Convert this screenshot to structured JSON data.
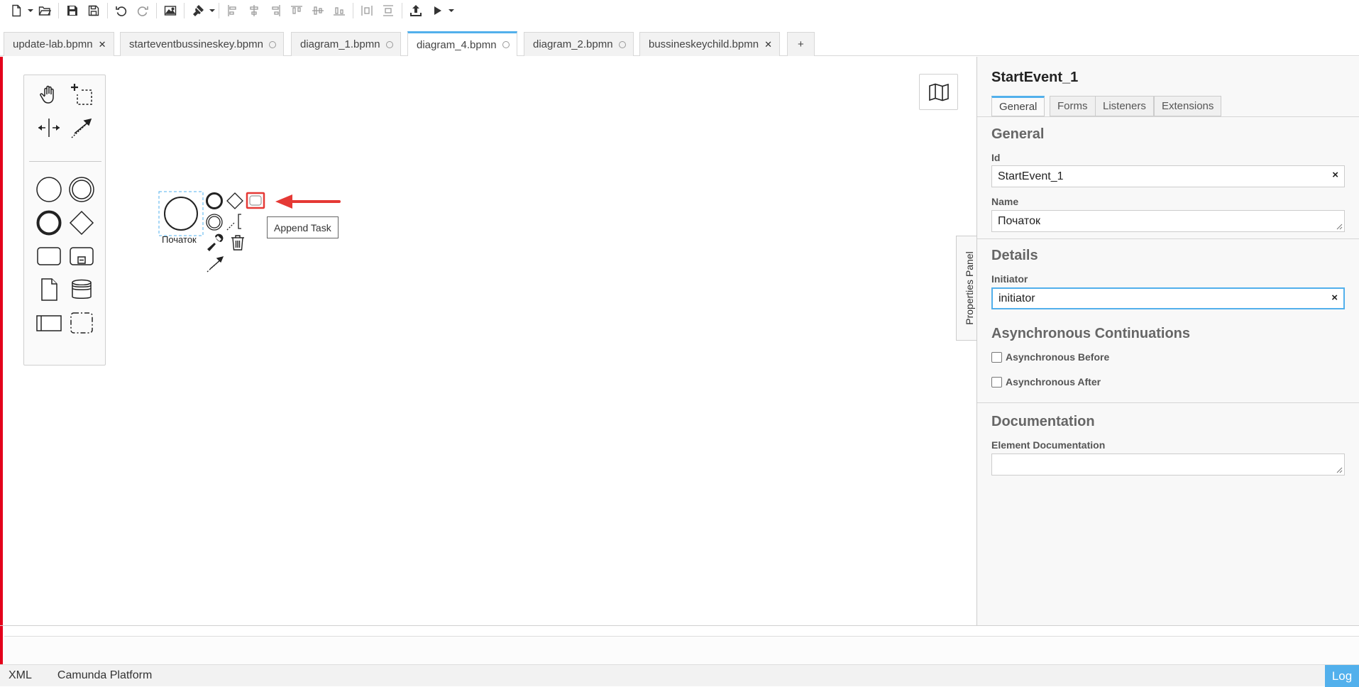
{
  "tabs": [
    {
      "label": "update-lab.bpmn",
      "status": "close"
    },
    {
      "label": "starteventbussineskey.bpmn",
      "status": "unsaved"
    },
    {
      "label": "diagram_1.bpmn",
      "status": "unsaved"
    },
    {
      "label": "diagram_4.bpmn",
      "status": "unsaved",
      "active": true
    },
    {
      "label": "diagram_2.bpmn",
      "status": "unsaved"
    },
    {
      "label": "bussineskeychild.bpmn",
      "status": "close"
    }
  ],
  "new_tab_label": "+",
  "canvas": {
    "element_label": "Початок",
    "tooltip": "Append Task",
    "highlight_color": "#e53935"
  },
  "props_toggle_label": "Properties Panel",
  "properties": {
    "title": "StartEvent_1",
    "tabs": [
      "General",
      "Forms",
      "Listeners",
      "Extensions"
    ],
    "groups": {
      "general": {
        "heading": "General",
        "id_label": "Id",
        "id_value": "StartEvent_1",
        "name_label": "Name",
        "name_value": "Початок"
      },
      "details": {
        "heading": "Details",
        "initiator_label": "Initiator",
        "initiator_value": "initiator"
      },
      "async": {
        "heading": "Asynchronous Continuations",
        "before_label": "Asynchronous Before",
        "after_label": "Asynchronous After"
      },
      "documentation": {
        "heading": "Documentation",
        "element_doc_label": "Element Documentation"
      }
    },
    "clear_symbol": "×"
  },
  "statusbar": {
    "xml": "XML",
    "platform": "Camunda Platform",
    "log": "Log"
  },
  "colors": {
    "accent": "#52b0ec",
    "red_bar": "#e4001b"
  }
}
